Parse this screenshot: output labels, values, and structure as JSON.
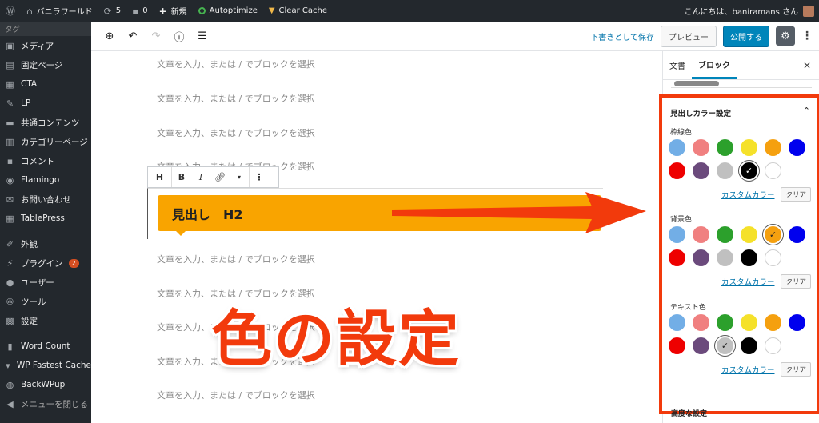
{
  "admin_bar": {
    "site_name": "バニラワールド",
    "updates_count": "5",
    "comments_count": "0",
    "new_label": "新規",
    "autoptimize_label": "Autoptimize",
    "clear_cache_label": "Clear Cache",
    "greeting": "こんにちは、baniramans さん"
  },
  "menu": {
    "tag_item": "タグ",
    "items": [
      {
        "label": "メディア",
        "icon": "media-icon"
      },
      {
        "label": "固定ページ",
        "icon": "page-icon"
      },
      {
        "label": "CTA",
        "icon": "cta-icon"
      },
      {
        "label": "LP",
        "icon": "lp-icon"
      },
      {
        "label": "共通コンテンツ",
        "icon": "folder-icon"
      },
      {
        "label": "カテゴリーページ",
        "icon": "category-icon"
      },
      {
        "label": "コメント",
        "icon": "comment-icon"
      },
      {
        "label": "Flamingo",
        "icon": "flamingo-icon"
      },
      {
        "label": "お問い合わせ",
        "icon": "mail-icon"
      },
      {
        "label": "TablePress",
        "icon": "table-icon"
      },
      {
        "label": "外観",
        "icon": "brush-icon"
      },
      {
        "label": "プラグイン",
        "icon": "plugin-icon",
        "badge": "2"
      },
      {
        "label": "ユーザー",
        "icon": "user-icon"
      },
      {
        "label": "ツール",
        "icon": "tool-icon"
      },
      {
        "label": "設定",
        "icon": "settings-icon"
      },
      {
        "label": "Word Count",
        "icon": "wordcount-icon"
      },
      {
        "label": "WP Fastest Cache",
        "icon": "cache-icon"
      },
      {
        "label": "BackWPup",
        "icon": "backup-icon"
      },
      {
        "label": "メニューを閉じる",
        "icon": "collapse-icon"
      }
    ]
  },
  "toolbar": {
    "save_draft": "下書きとして保存",
    "preview": "プレビュー",
    "publish": "公開する"
  },
  "editor": {
    "placeholder": "文章を入力、または / でブロックを選択",
    "heading_text": "見出し　H2",
    "block_type": "H",
    "bold": "B",
    "italic": "I",
    "annotation": "色の設定"
  },
  "sidebar": {
    "tab_document": "文書",
    "tab_block": "ブロック",
    "panel_title": "見出しカラー設定",
    "custom_color": "カスタムカラー",
    "clear": "クリア",
    "next_section": "高度な設定",
    "groups": [
      {
        "label": "枠線色",
        "selected": 9
      },
      {
        "label": "背景色",
        "selected": 4
      },
      {
        "label": "テキスト色",
        "selected": 8
      }
    ],
    "palette": [
      "#72aee6",
      "#f08080",
      "#2ca02c",
      "#f5e12a",
      "#f5a00f",
      "#0000ee",
      "#ee0000",
      "#6b4a7c",
      "#c0c0c0",
      "#000000",
      "#ffffff"
    ]
  }
}
